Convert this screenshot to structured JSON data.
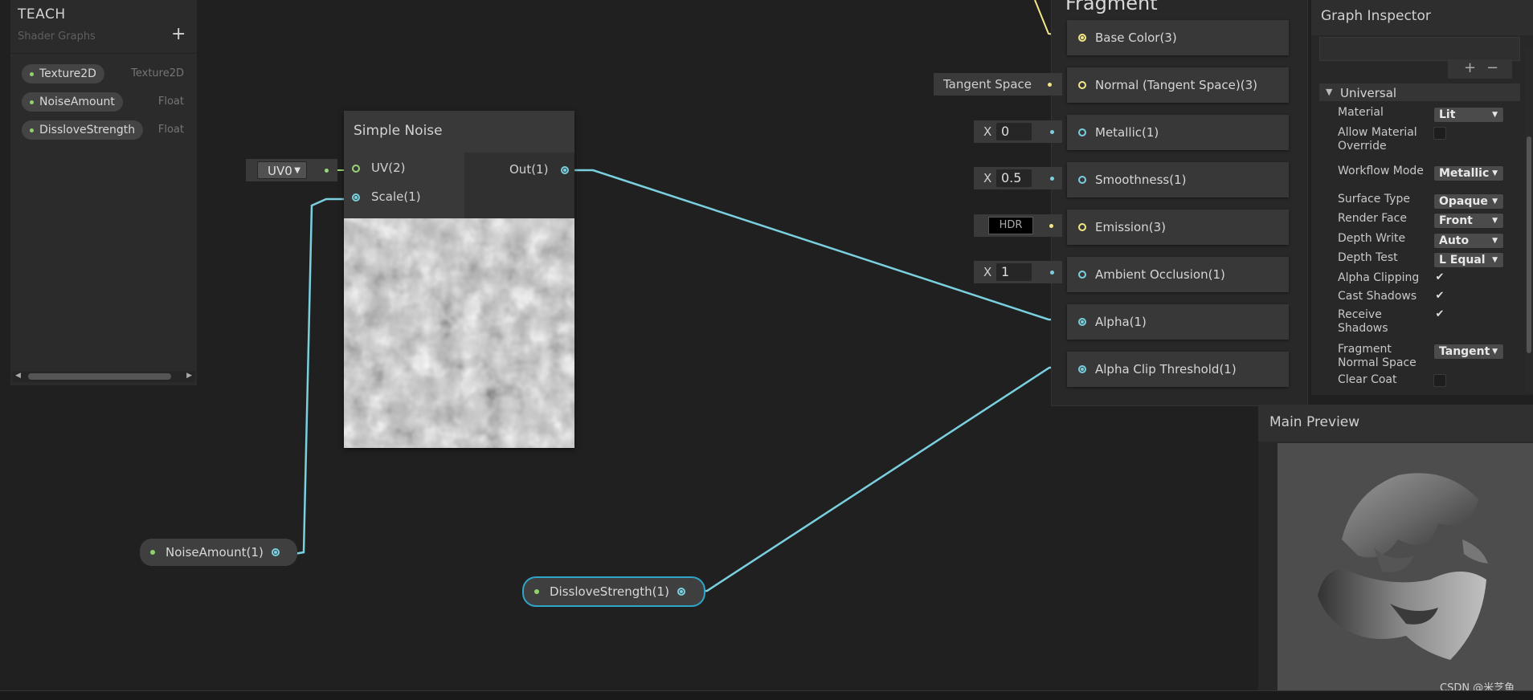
{
  "blackboard": {
    "title": "TEACH",
    "subtitle": "Shader Graphs",
    "add_label": "+",
    "properties": [
      {
        "name": "Texture2D",
        "type": "Texture2D"
      },
      {
        "name": "NoiseAmount",
        "type": "Float"
      },
      {
        "name": "DissloveStrength",
        "type": "Float"
      }
    ]
  },
  "noise_node": {
    "title": "Simple Noise",
    "inputs": [
      "UV(2)",
      "Scale(1)"
    ],
    "output": "Out(1)",
    "uv_value": "UV0"
  },
  "property_nodes": {
    "noise_amount": "NoiseAmount(1)",
    "dissolve_strength": "DissloveStrength(1)"
  },
  "fragment": {
    "title": "Fragment",
    "blocks": [
      {
        "label": "Base Color(3)",
        "port": "yellow"
      },
      {
        "label": "Normal (Tangent Space)(3)",
        "port": "yellow"
      },
      {
        "label": "Metallic(1)",
        "port": "cyan"
      },
      {
        "label": "Smoothness(1)",
        "port": "cyan"
      },
      {
        "label": "Emission(3)",
        "port": "yellow"
      },
      {
        "label": "Ambient Occlusion(1)",
        "port": "cyan"
      },
      {
        "label": "Alpha(1)",
        "port": "cyan"
      },
      {
        "label": "Alpha Clip Threshold(1)",
        "port": "cyan"
      }
    ],
    "fields": {
      "normal_space": "Tangent Space",
      "x_label": "X",
      "metallic": "0",
      "smoothness": "0.5",
      "emission": "HDR",
      "ambient_occlusion": "1"
    }
  },
  "inspector": {
    "title": "Graph Inspector",
    "plus": "+",
    "minus": "−",
    "section": "Universal",
    "rows": [
      {
        "label": "Material",
        "kind": "dropdown",
        "value": "Lit"
      },
      {
        "label": "Allow Material Override",
        "kind": "check",
        "checked": false
      },
      {
        "label": "Workflow Mode",
        "kind": "dropdown",
        "value": "Metallic"
      },
      {
        "label": "Surface Type",
        "kind": "dropdown",
        "value": "Opaque"
      },
      {
        "label": "Render Face",
        "kind": "dropdown",
        "value": "Front"
      },
      {
        "label": "Depth Write",
        "kind": "dropdown",
        "value": "Auto"
      },
      {
        "label": "Depth Test",
        "kind": "dropdown",
        "value": "L Equal"
      },
      {
        "label": "Alpha Clipping",
        "kind": "check",
        "checked": true
      },
      {
        "label": "Cast Shadows",
        "kind": "check",
        "checked": true
      },
      {
        "label": "Receive Shadows",
        "kind": "check",
        "checked": true
      },
      {
        "label": "Fragment Normal Space",
        "kind": "dropdown",
        "value": "Tangent"
      },
      {
        "label": "Clear Coat",
        "kind": "check",
        "checked": false
      }
    ]
  },
  "preview": {
    "title": "Main Preview"
  },
  "watermark": "CSDN @米芝鱼",
  "colors": {
    "wire_cyan": "#7ad0df",
    "wire_yellow": "#f3e887",
    "wire_green": "#9ad37a",
    "selection": "#2fa6c9"
  }
}
